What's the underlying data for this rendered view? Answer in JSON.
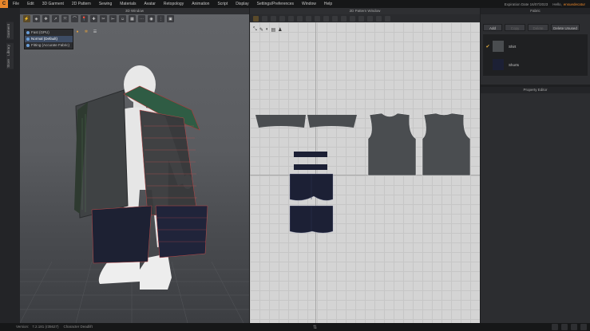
{
  "menubar": {
    "logo": "C",
    "items": [
      "File",
      "Edit",
      "3D Garment",
      "2D Pattern",
      "Sewing",
      "Materials",
      "Avatar",
      "Retopology",
      "Animation",
      "Script",
      "Display",
      "Settings/Preferences",
      "Window",
      "Help"
    ],
    "expiration": "Expiration Date 16/07/2023",
    "hello": "Hello,",
    "username": "ensuedecatur"
  },
  "window3d": {
    "title": "3D Window",
    "sim_menu": {
      "items": [
        "Fast (GPU)",
        "Normal (Default)",
        "Fitting (Accurate Fabric)"
      ],
      "selected": "Normal (Default)"
    }
  },
  "window2d": {
    "title": "2D Pattern Window"
  },
  "side_tabs": [
    "Garment",
    "Library",
    "Store"
  ],
  "fabric_panel": {
    "title": "Fabric",
    "buttons": {
      "add": "Add",
      "copy": "Copy",
      "delete": "Delete",
      "delete_unused": "Delete Unused"
    },
    "items": [
      {
        "name": "Shirt",
        "color": "#4a4d50",
        "checked": true
      },
      {
        "name": "Shorts",
        "color": "#1c2035",
        "checked": false
      }
    ]
  },
  "property_panel": {
    "title": "Property Editor"
  },
  "statusbar": {
    "version_label": "Version:",
    "version": "7.2.181 (r35627)",
    "status": "Character Deadlift"
  },
  "colors": {
    "shirt": "#4a4d50",
    "shorts": "#1c2035",
    "accent": "#e8862a",
    "grid_bg": "#d4d4d4"
  }
}
